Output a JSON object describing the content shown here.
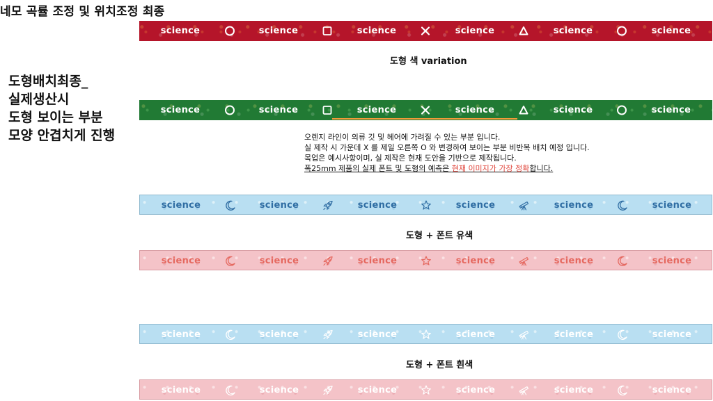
{
  "page_title": "네모 곡률 조정 및 위치조정 최종",
  "side_note": [
    "도형배치최종_",
    "실제생산시",
    "도형 보이는 부분",
    "모양 안겹치게 진행"
  ],
  "labels": {
    "color_variation": "도형 색 variation",
    "shape_font_color": "도형 + 폰트 유색",
    "shape_font_white": "도형 + 폰트 흰색"
  },
  "notes": {
    "line1": "오렌지 라인이 의류 깃 및 헤어에 가려질 수 있는 부분 입니다.",
    "line2": "실 제작 시 가운데 X 를 제일 오른쪽 O 와 변경하여 보이는 부분 비반복 배치 예정 입니다.",
    "line3": "목업은 예시사항이며, 실 제작은 현재 도안을 기반으로 제작됩니다.",
    "line4_pre": "폭25mm 제품의 실제 폰트 및 도형의 예측은 ",
    "line4_highlight": "현재 이미지가 가장 정확",
    "line4_post": "합니다."
  },
  "strap_word": "science",
  "colors": {
    "red_strap": "#b5152a",
    "green_strap": "#217a34",
    "blue_strap": "#b9dff2",
    "pink_strap": "#f4c3c8",
    "blue_text": "#2f6da3",
    "red_text": "#e5685f",
    "highlight": "#e0443a",
    "orange_line": "#f29a3a"
  },
  "straps": [
    {
      "id": "strap-red-geometric",
      "style": "red",
      "text_color": "white",
      "symbols": [
        "circle-icon",
        "square-icon",
        "x-icon",
        "triangle-icon",
        "circle-icon"
      ]
    },
    {
      "id": "strap-green-geometric",
      "style": "green",
      "text_color": "white",
      "symbols": [
        "circle-icon",
        "square-icon",
        "x-icon",
        "triangle-icon",
        "circle-icon"
      ]
    },
    {
      "id": "strap-blue-colored",
      "style": "blue",
      "text_color": "blue",
      "symbols": [
        "moon-icon",
        "rocket-icon",
        "star-icon",
        "telescope-icon",
        "moon-icon"
      ]
    },
    {
      "id": "strap-pink-colored",
      "style": "pink",
      "text_color": "red",
      "symbols": [
        "moon-icon",
        "rocket-icon",
        "star-icon",
        "telescope-icon",
        "moon-icon"
      ]
    },
    {
      "id": "strap-blue-white",
      "style": "blue",
      "text_color": "white",
      "symbols": [
        "moon-icon",
        "rocket-icon",
        "star-icon",
        "telescope-icon",
        "moon-icon"
      ]
    },
    {
      "id": "strap-pink-white",
      "style": "pink",
      "text_color": "white",
      "symbols": [
        "moon-icon",
        "rocket-icon",
        "star-icon",
        "telescope-icon",
        "moon-icon"
      ]
    }
  ]
}
